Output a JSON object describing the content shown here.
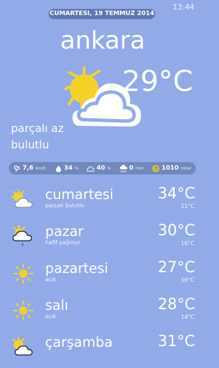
{
  "status": {
    "time": "13:44"
  },
  "header": {
    "date": "CUMARTESI, 19 TEMMUZ 2014",
    "city": "ankara"
  },
  "current": {
    "temperature": "29°C",
    "condition": "parçalı az bulutlu",
    "icon": "partly-cloudy-icon"
  },
  "metrics": [
    {
      "name": "wind",
      "icon": "wind-icon",
      "value": "7,6",
      "unit": "km/h"
    },
    {
      "name": "humidity",
      "icon": "humidity-icon",
      "value": "34",
      "unit": "%"
    },
    {
      "name": "cloud",
      "icon": "cloud-icon",
      "value": "40",
      "unit": "%"
    },
    {
      "name": "precipitation",
      "icon": "rain-icon",
      "value": "0",
      "unit": "mm"
    },
    {
      "name": "pressure",
      "icon": "pressure-icon",
      "value": "1010",
      "unit": "mbar"
    }
  ],
  "forecast": [
    {
      "day": "cumartesi",
      "desc": "parçalı bulutlu",
      "high": "34°C",
      "low": "21°C",
      "icon": "partly-cloudy-icon"
    },
    {
      "day": "pazar",
      "desc": "hafif yağmur",
      "high": "30°C",
      "low": "16°C",
      "icon": "light-rain-icon"
    },
    {
      "day": "pazartesi",
      "desc": "açık",
      "high": "27°C",
      "low": "16°C",
      "icon": "sun-icon"
    },
    {
      "day": "salı",
      "desc": "açık",
      "high": "28°C",
      "low": "14°C",
      "icon": "sun-icon"
    },
    {
      "day": "çarşamba",
      "desc": "",
      "high": "31°C",
      "low": "",
      "icon": "partly-cloudy-icon"
    }
  ]
}
